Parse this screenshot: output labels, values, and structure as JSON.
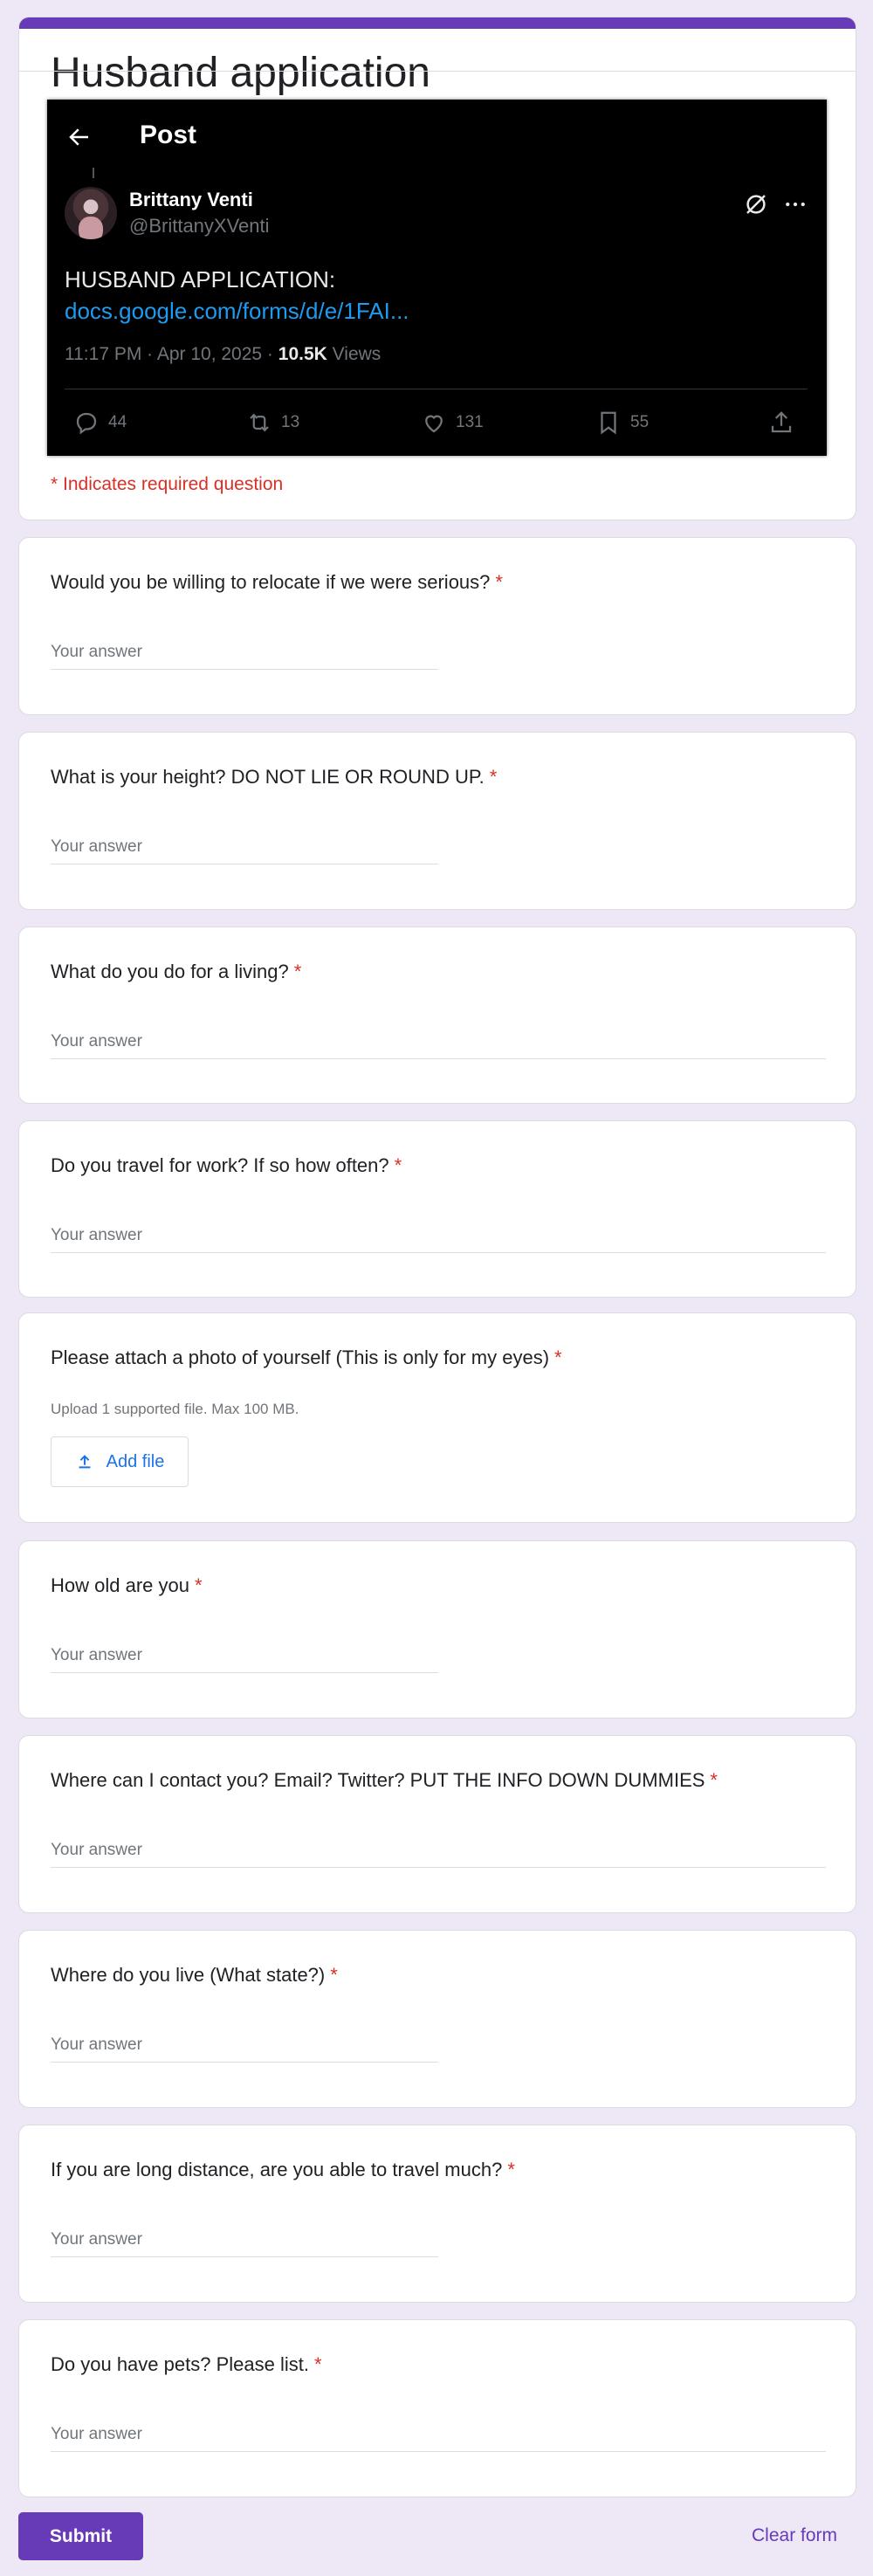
{
  "form": {
    "title": "Husband application",
    "required_note": "* Indicates required question",
    "accent_color": "#673ab7"
  },
  "post": {
    "heading": "Post",
    "author_name": "Brittany Venti",
    "author_handle": "@BrittanyXVenti",
    "text": "HUSBAND APPLICATION:",
    "link": "docs.google.com/forms/d/e/1FAI...",
    "time_date": "11:17 PM · Apr 10, 2025 · ",
    "views_count": "10.5K",
    "views_label": " Views",
    "replies": "44",
    "reposts": "13",
    "likes": "131",
    "bookmarks": "55",
    "icons": [
      "back-arrow-icon",
      "grok-icon",
      "more-icon",
      "reply-icon",
      "repost-icon",
      "like-icon",
      "bookmark-icon",
      "share-icon"
    ]
  },
  "questions": [
    {
      "title": "Would you be willing to relocate if we were serious?",
      "placeholder": "Your answer"
    },
    {
      "title": "What is your height? DO NOT LIE OR ROUND UP.",
      "placeholder": "Your answer"
    },
    {
      "title": "What do you do for a living?",
      "placeholder": "Your answer"
    },
    {
      "title": "Do you travel for work? If so how often?",
      "placeholder": "Your answer"
    },
    {
      "title": "Please attach a photo of yourself (This is only for my eyes)",
      "upload_note": "Upload 1 supported file. Max 100 MB.",
      "button_label": "Add file"
    },
    {
      "title": "How old are you",
      "placeholder": "Your answer"
    },
    {
      "title": "Where can I contact you? Email? Twitter? PUT THE INFO DOWN DUMMIES",
      "placeholder": "Your answer"
    },
    {
      "title": "Where do you live (What state?)",
      "placeholder": "Your answer"
    },
    {
      "title": "If you are long distance, are you able to travel much?",
      "placeholder": "Your answer"
    },
    {
      "title": "Do you have pets? Please list.",
      "placeholder": "Your answer"
    }
  ],
  "required_marker": "*",
  "actions": {
    "submit_label": "Submit",
    "clear_label": "Clear form"
  }
}
